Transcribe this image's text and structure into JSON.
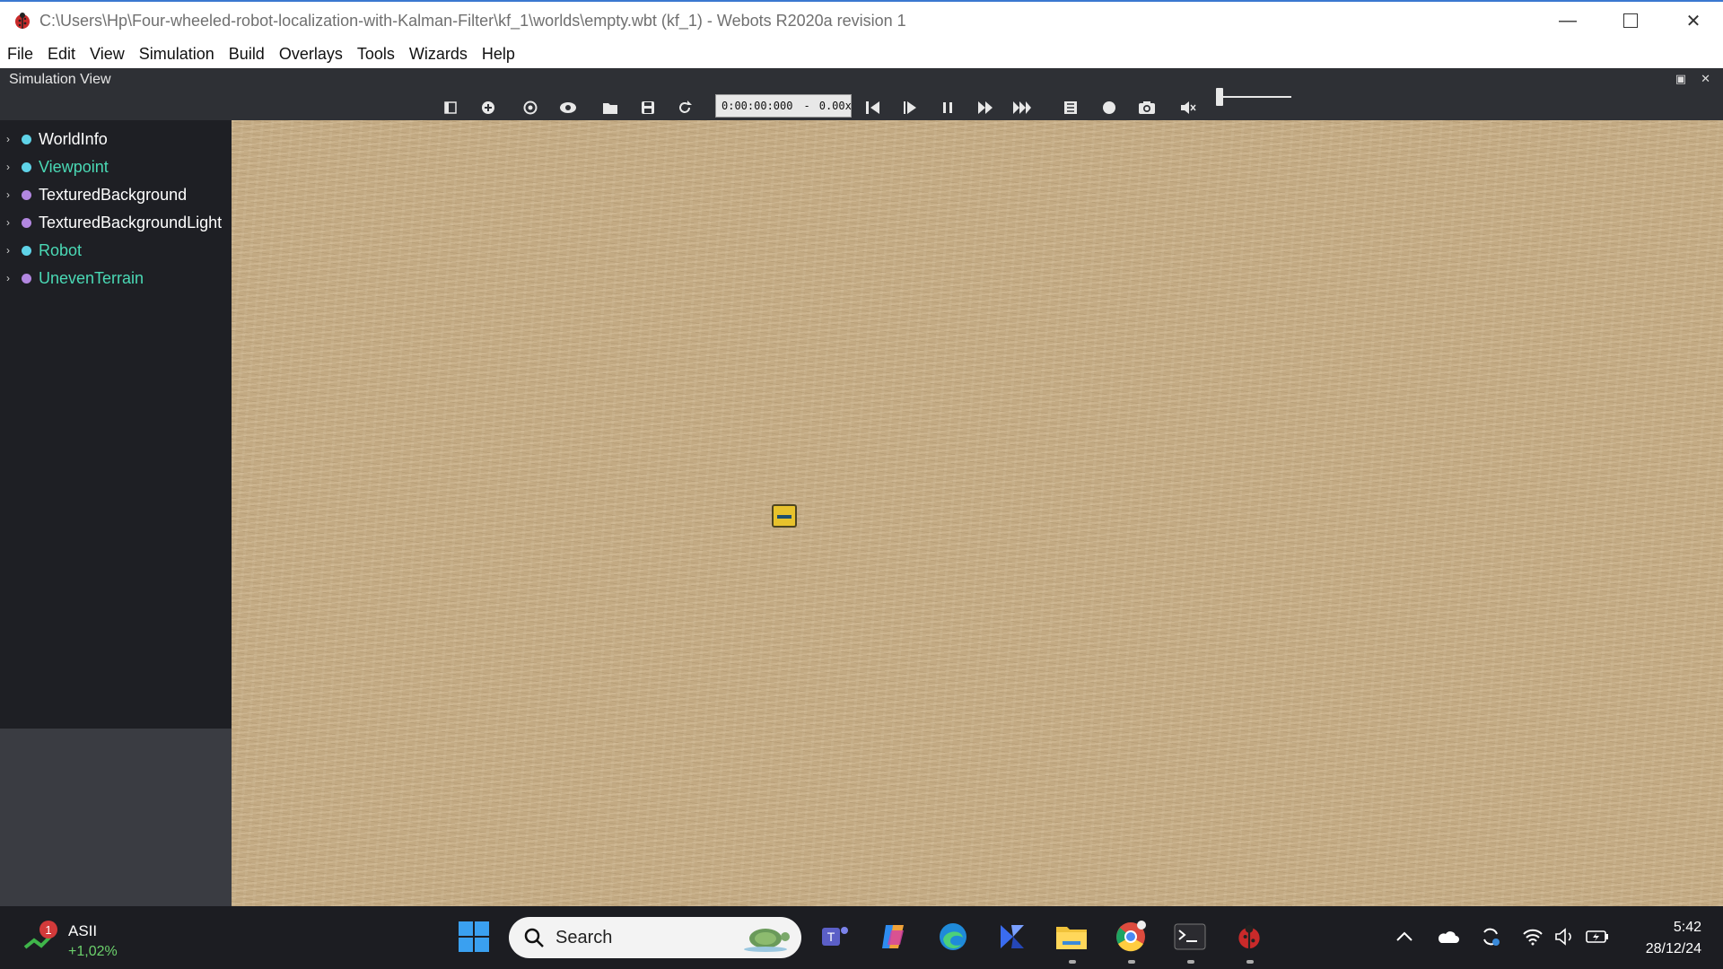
{
  "window": {
    "title": "C:\\Users\\Hp\\Four-wheeled-robot-localization-with-Kalman-Filter\\kf_1\\worlds\\empty.wbt (kf_1) - Webots R2020a revision 1",
    "app_icon": "ladybug-icon",
    "controls": [
      "minimize-icon",
      "maximize-icon",
      "close-icon"
    ]
  },
  "menu": {
    "items": [
      "File",
      "Edit",
      "View",
      "Simulation",
      "Build",
      "Overlays",
      "Tools",
      "Wizards",
      "Help"
    ]
  },
  "simulation_view": {
    "label": "Simulation View",
    "toolbar_icons": [
      "hide-scene-tree-icon",
      "add-node-icon",
      "restore-viewpoint-icon",
      "view-icon",
      "open-world-icon",
      "save-world-icon",
      "reload-world-icon",
      "reset-icon",
      "step-icon",
      "pause-icon",
      "run-icon",
      "fast-icon",
      "record-video-icon",
      "record-animation-icon",
      "screenshot-icon",
      "mute-icon"
    ],
    "time": "0:00:00:000",
    "time_separator": "-",
    "speed": "0.00x",
    "volume_level": 0.0
  },
  "scene_tree": {
    "nodes": [
      {
        "label": "WorldInfo",
        "color": "#ffffff",
        "dot": "#5fd3e8"
      },
      {
        "label": "Viewpoint",
        "color": "#4ad9b5",
        "dot": "#5fd3e8"
      },
      {
        "label": "TexturedBackground",
        "color": "#ffffff",
        "dot": "#b287e0"
      },
      {
        "label": "TexturedBackgroundLight",
        "color": "#ffffff",
        "dot": "#b287e0"
      },
      {
        "label": "Robot",
        "color": "#4ad9b5",
        "dot": "#5fd3e8"
      },
      {
        "label": "UnevenTerrain",
        "color": "#4ad9b5",
        "dot": "#b287e0"
      }
    ]
  },
  "taskbar": {
    "stock": {
      "name": "ASII",
      "change": "+1,02%",
      "badge": "1"
    },
    "search_placeholder": "Search",
    "apps": [
      "windows-start-icon",
      "teams-icon",
      "copilot-icon",
      "edge-icon",
      "power-automate-icon",
      "file-explorer-icon",
      "chrome-icon",
      "terminal-icon",
      "webots-icon"
    ],
    "tray": [
      "chevron-up-icon",
      "onedrive-icon",
      "sync-icon",
      "wifi-icon",
      "volume-icon",
      "battery-icon"
    ],
    "time": "5:42",
    "date": "28/12/24"
  }
}
